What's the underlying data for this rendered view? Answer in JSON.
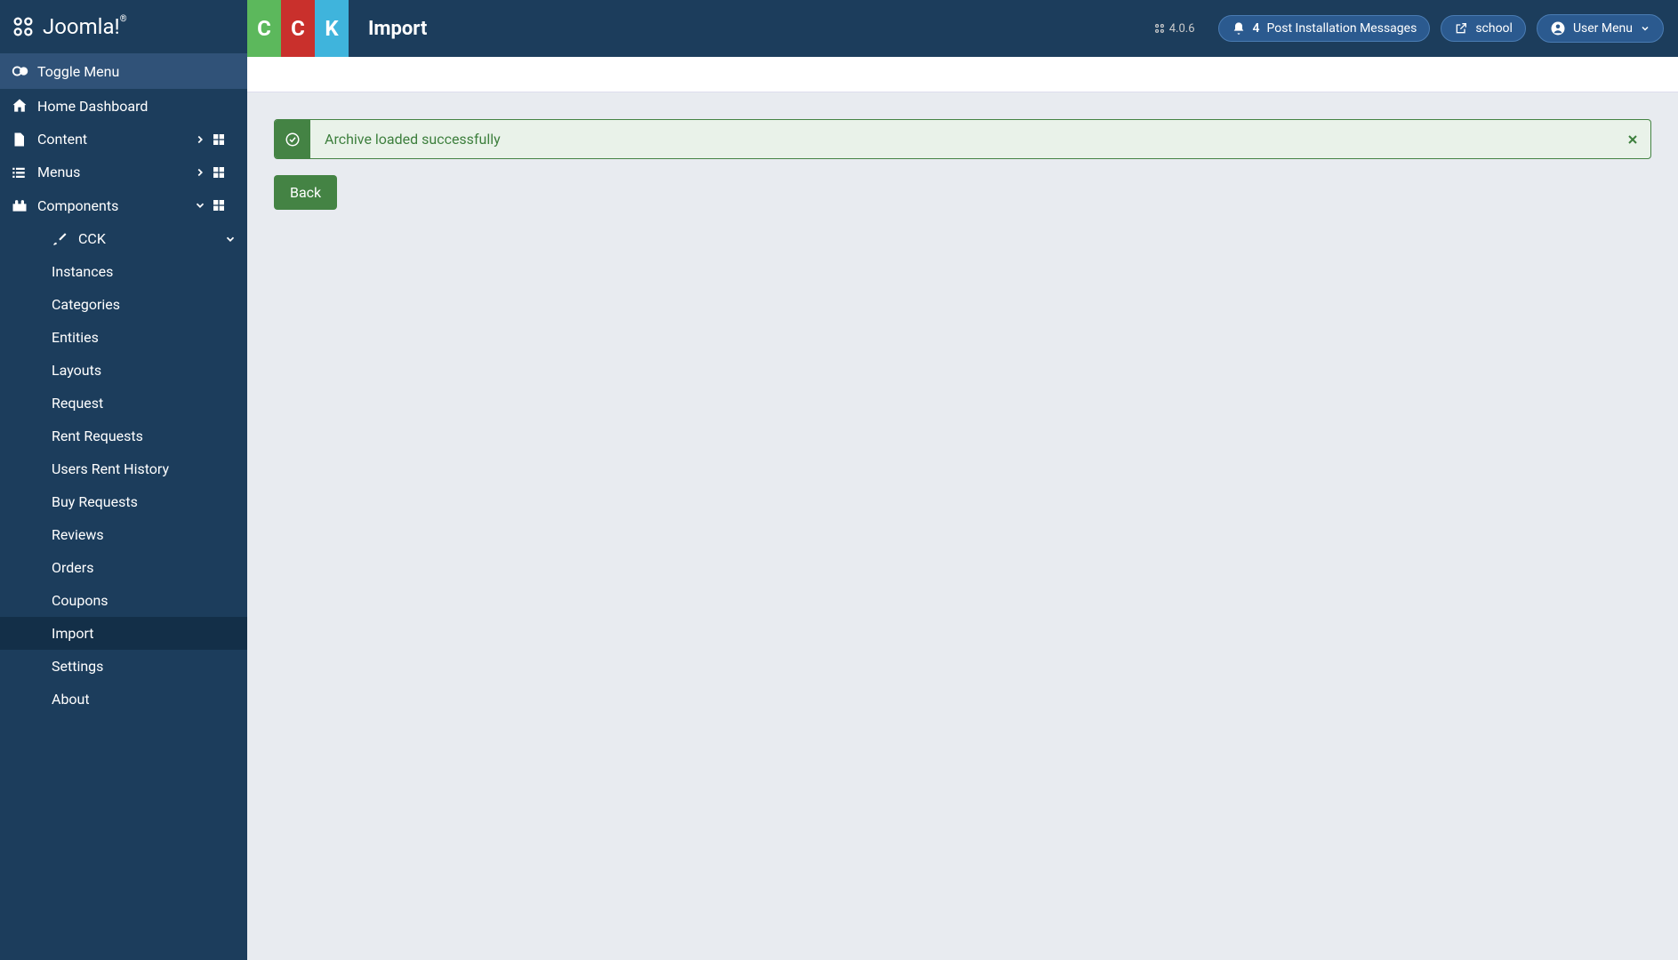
{
  "brand": "Joomla!",
  "sidebar": {
    "toggle": "Toggle Menu",
    "home": "Home Dashboard",
    "content": "Content",
    "menus": "Menus",
    "components": "Components",
    "cck": "CCK",
    "sub": {
      "instances": "Instances",
      "categories": "Categories",
      "entities": "Entities",
      "layouts": "Layouts",
      "request": "Request",
      "rent_requests": "Rent Requests",
      "users_rent_history": "Users Rent History",
      "buy_requests": "Buy Requests",
      "reviews": "Reviews",
      "orders": "Orders",
      "coupons": "Coupons",
      "import": "Import",
      "settings": "Settings",
      "about": "About"
    }
  },
  "topbar": {
    "cck_1": "C",
    "cck_2": "C",
    "cck_3": "K",
    "title": "Import",
    "version": "4.0.6",
    "notifications_count": "4",
    "post_install": "Post Installation Messages",
    "school": "school",
    "user_menu": "User Menu"
  },
  "alert": {
    "message": "Archive loaded successfully"
  },
  "buttons": {
    "back": "Back"
  }
}
